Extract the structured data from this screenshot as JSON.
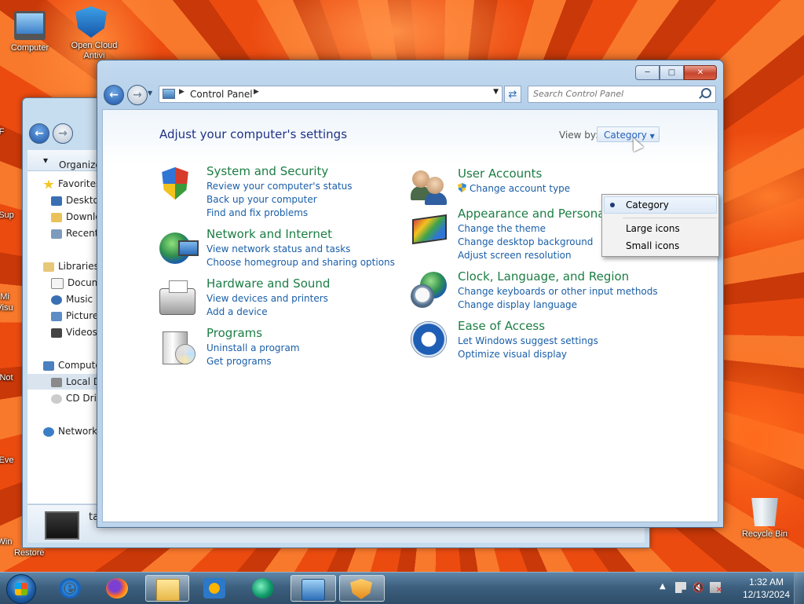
{
  "desktop": {
    "icons": [
      {
        "label": "Computer"
      },
      {
        "label": "Open Cloud Antivi"
      },
      {
        "label": "Recycle Bin"
      }
    ],
    "partial_labels": [
      "F",
      "Sup",
      "Mi",
      "Visu",
      "Not",
      "Eve",
      "Win",
      "Restore"
    ]
  },
  "bg_explorer": {
    "organize_label": "Organize",
    "tree": [
      "Favorites",
      "Deskto",
      "Downlo",
      "Recent",
      "Libraries",
      "Docum",
      "Music",
      "Picture",
      "Videos",
      "Compute",
      "Local D",
      "CD Driv",
      "Network"
    ],
    "details_title": "ta"
  },
  "control_panel": {
    "address": {
      "root": "Control Panel"
    },
    "search": {
      "placeholder": "Search Control Panel"
    },
    "heading": "Adjust your computer's settings",
    "view_by_label": "View by:",
    "view_by_value": "Category",
    "categories_left": [
      {
        "title": "System and Security",
        "links": [
          "Review your computer's status",
          "Back up your computer",
          "Find and fix problems"
        ],
        "icon": "shield-icon"
      },
      {
        "title": "Network and Internet",
        "links": [
          "View network status and tasks",
          "Choose homegroup and sharing options"
        ],
        "icon": "network-globe-icon"
      },
      {
        "title": "Hardware and Sound",
        "links": [
          "View devices and printers",
          "Add a device"
        ],
        "icon": "printer-icon"
      },
      {
        "title": "Programs",
        "links": [
          "Uninstall a program",
          "Get programs"
        ],
        "icon": "programs-icon"
      }
    ],
    "categories_right": [
      {
        "title": "User Accounts",
        "links": [
          "Change account type"
        ],
        "icon": "users-icon"
      },
      {
        "title": "Appearance and Personalization",
        "links": [
          "Change the theme",
          "Change desktop background",
          "Adjust screen resolution"
        ],
        "icon": "appearance-icon"
      },
      {
        "title": "Clock, Language, and Region",
        "links": [
          "Change keyboards or other input methods",
          "Change display language"
        ],
        "icon": "clock-globe-icon"
      },
      {
        "title": "Ease of Access",
        "links": [
          "Let Windows suggest settings",
          "Optimize visual display"
        ],
        "icon": "ease-of-access-icon"
      }
    ],
    "view_menu": {
      "items": [
        "Category",
        "Large icons",
        "Small icons"
      ],
      "selected": "Category"
    }
  },
  "taskbar": {
    "time": "1:32 AM",
    "date": "12/13/2024",
    "apps": [
      "internet-explorer-icon",
      "firefox-icon",
      "explorer-folder-icon",
      "media-player-icon",
      "green-app-icon",
      "control-panel-icon",
      "shield-app-icon"
    ]
  },
  "colors": {
    "category_title": "#1c7d44",
    "link": "#1a5ea8",
    "heading": "#1e3287"
  }
}
